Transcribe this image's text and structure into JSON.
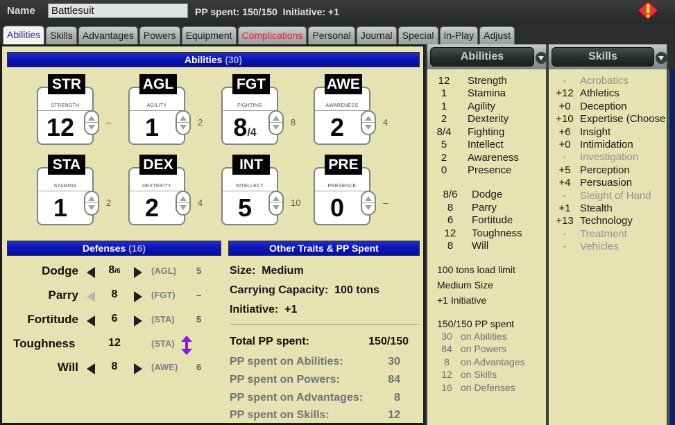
{
  "header": {
    "name_label": "Name",
    "name_value": "Battlesuit",
    "pp_summary": "PP spent: 150/150  Initiative: +1",
    "warning_icon": "warning-diamond-icon"
  },
  "tabs": [
    {
      "label": "Abilities",
      "active": true
    },
    {
      "label": "Skills"
    },
    {
      "label": "Advantages"
    },
    {
      "label": "Powers"
    },
    {
      "label": "Equipment"
    },
    {
      "label": "Complications",
      "color": "#e8204a"
    },
    {
      "label": "Personal"
    },
    {
      "label": "Journal"
    },
    {
      "label": "Special"
    },
    {
      "label": "In-Play"
    },
    {
      "label": "Adjust"
    }
  ],
  "abilities_section": {
    "title": "Abilities",
    "count": "(30)",
    "items": [
      {
        "abbr": "STR",
        "name": "STRENGTH",
        "value": "12",
        "suffix": "",
        "cost": "–"
      },
      {
        "abbr": "AGL",
        "name": "AGILITY",
        "value": "1",
        "suffix": "",
        "cost": "2"
      },
      {
        "abbr": "FGT",
        "name": "FIGHTING",
        "value": "8",
        "suffix": "/4",
        "cost": "8"
      },
      {
        "abbr": "AWE",
        "name": "AWARENESS",
        "value": "2",
        "suffix": "",
        "cost": "4"
      },
      {
        "abbr": "STA",
        "name": "STAMINA",
        "value": "1",
        "suffix": "",
        "cost": "2"
      },
      {
        "abbr": "DEX",
        "name": "DEXTERITY",
        "value": "2",
        "suffix": "",
        "cost": "4"
      },
      {
        "abbr": "INT",
        "name": "INTELLECT",
        "value": "5",
        "suffix": "",
        "cost": "10"
      },
      {
        "abbr": "PRE",
        "name": "PRESENCE",
        "value": "0",
        "suffix": "",
        "cost": "–"
      }
    ]
  },
  "defenses_section": {
    "title": "Defenses",
    "count": "(16)",
    "items": [
      {
        "name": "Dodge",
        "value": "8",
        "suffix": "/6",
        "ability": "(AGL)",
        "cost": "5"
      },
      {
        "name": "Parry",
        "value": "8",
        "suffix": "",
        "ability": "(FGT)",
        "cost": "–"
      },
      {
        "name": "Fortitude",
        "value": "6",
        "suffix": "",
        "ability": "(STA)",
        "cost": "5"
      },
      {
        "name": "Toughness",
        "value": "12",
        "suffix": "",
        "ability": "(STA)",
        "cost": ""
      },
      {
        "name": "Will",
        "value": "8",
        "suffix": "",
        "ability": "(AWE)",
        "cost": "6"
      }
    ]
  },
  "other_section": {
    "title": "Other Traits & PP Spent",
    "size": "Size:  Medium",
    "carrying": "Carrying Capacity:  100 tons",
    "initiative": "Initiative:  +1",
    "total_label": "Total PP spent:",
    "total_value": "150/150",
    "pp_rows": [
      {
        "label": "PP spent on Abilities:",
        "value": "30"
      },
      {
        "label": "PP spent on Powers:",
        "value": "84"
      },
      {
        "label": "PP spent on Advantages:",
        "value": "8"
      },
      {
        "label": "PP spent on Skills:",
        "value": "12"
      }
    ]
  },
  "abilities_panel": {
    "header": "Abilities",
    "abilities": [
      {
        "value": "12",
        "name": "Strength"
      },
      {
        "value": "1",
        "name": "Stamina"
      },
      {
        "value": "1",
        "name": "Agility"
      },
      {
        "value": "2",
        "name": "Dexterity"
      },
      {
        "value": "8/4",
        "name": "Fighting"
      },
      {
        "value": "5",
        "name": "Intellect"
      },
      {
        "value": "2",
        "name": "Awareness"
      },
      {
        "value": "0",
        "name": "Presence"
      }
    ],
    "defenses": [
      {
        "value": "8/6",
        "name": "Dodge"
      },
      {
        "value": "8",
        "name": "Parry"
      },
      {
        "value": "6",
        "name": "Fortitude"
      },
      {
        "value": "12",
        "name": "Toughness"
      },
      {
        "value": "8",
        "name": "Will"
      }
    ],
    "notes": [
      "100 tons load limit",
      "Medium Size",
      "+1 Initiative"
    ],
    "pp_total": "150/150 PP spent",
    "pp_breakdown": [
      {
        "value": "30",
        "label": "on Abilities"
      },
      {
        "value": "84",
        "label": "on Powers"
      },
      {
        "value": "8",
        "label": "on Advantages"
      },
      {
        "value": "12",
        "label": "on Skills"
      },
      {
        "value": "16",
        "label": "on Defenses"
      }
    ]
  },
  "skills_panel": {
    "header": "Skills",
    "skills": [
      {
        "value": "-",
        "name": "Acrobatics",
        "trained": false
      },
      {
        "value": "+12",
        "name": "Athletics",
        "trained": true
      },
      {
        "value": "+0",
        "name": "Deception",
        "trained": true
      },
      {
        "value": "+10",
        "name": "Expertise (Choose",
        "trained": true
      },
      {
        "value": "+6",
        "name": "Insight",
        "trained": true
      },
      {
        "value": "+0",
        "name": "Intimidation",
        "trained": true
      },
      {
        "value": "-",
        "name": "Investigation",
        "trained": false
      },
      {
        "value": "+5",
        "name": "Perception",
        "trained": true
      },
      {
        "value": "+4",
        "name": "Persuasion",
        "trained": true
      },
      {
        "value": "-",
        "name": "Sleight of Hand",
        "trained": false
      },
      {
        "value": "+1",
        "name": "Stealth",
        "trained": true
      },
      {
        "value": "+13",
        "name": "Technology",
        "trained": true
      },
      {
        "value": "-",
        "name": "Treatment",
        "trained": false
      },
      {
        "value": "-",
        "name": "Vehicles",
        "trained": false
      }
    ]
  },
  "colors": {
    "section_header": "#0a14b4",
    "panel_bg": "#e6e2b2",
    "active_tab_text": "#3a1fa8",
    "complications_tab": "#e8204a",
    "toughness_icon": "#8a16e8",
    "warning": "#d4202a"
  }
}
